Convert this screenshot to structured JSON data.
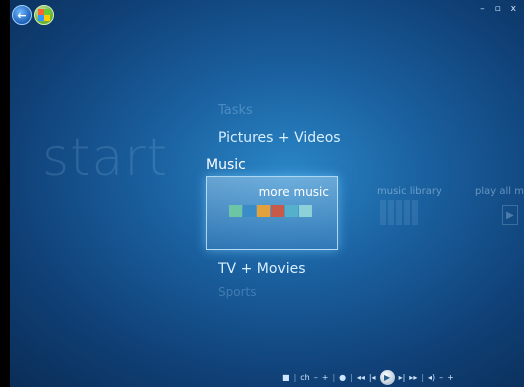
{
  "watermark": "start",
  "menu": {
    "tasks": "Tasks",
    "pictures": "Pictures + Videos",
    "music": "Music",
    "tv": "TV + Movies",
    "sports": "Sports"
  },
  "tile": {
    "label": "more music",
    "thumb_colors": [
      "#6cc6a6",
      "#3a8cc7",
      "#e2a13a",
      "#c85a4a",
      "#55b0cc",
      "#8cd0d8"
    ]
  },
  "secondary": {
    "music_library": "music library",
    "play_all": "play all m"
  },
  "window_controls": {
    "minimize": "–",
    "maximize": "▫",
    "close": "x"
  },
  "transport": {
    "ch_label": "ch",
    "minus": "–",
    "plus": "+",
    "vol_minus": "–",
    "vol_plus": "+"
  },
  "icons": [
    "back-arrow-icon",
    "windows-start-icon",
    "stop-icon",
    "record-icon",
    "rewind-icon",
    "skip-back-icon",
    "play-icon",
    "skip-forward-icon",
    "fast-forward-icon",
    "volume-icon"
  ]
}
